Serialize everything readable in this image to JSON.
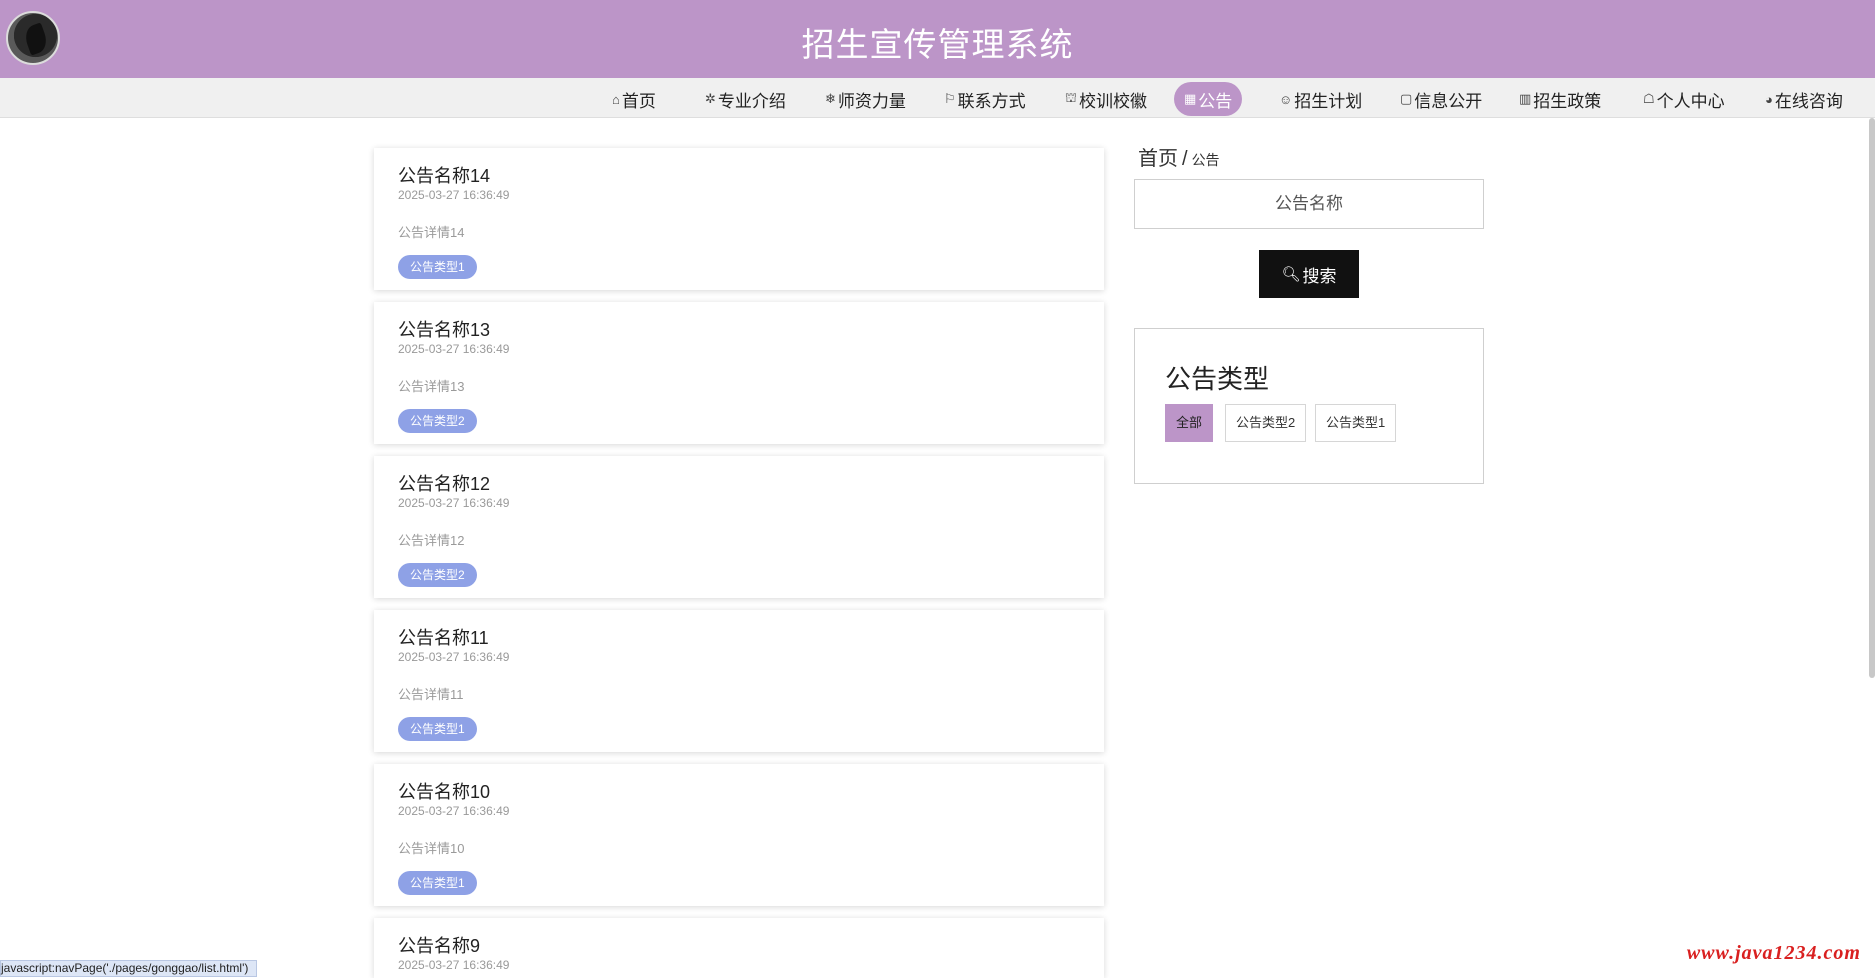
{
  "header": {
    "site_title": "招生宣传管理系统",
    "logo_icon": "avatar-logo"
  },
  "nav": {
    "items": [
      {
        "icon": "home-icon",
        "glyph": "⌂",
        "label": "首页"
      },
      {
        "icon": "star-outline-icon",
        "glyph": "✲",
        "label": "专业介绍"
      },
      {
        "icon": "snowflake-icon",
        "glyph": "❄",
        "label": "师资力量"
      },
      {
        "icon": "flag-icon",
        "glyph": "⚐",
        "label": "联系方式"
      },
      {
        "icon": "gift-icon",
        "glyph": "⛫",
        "label": "校训校徽"
      },
      {
        "icon": "grid-icon",
        "glyph": "▦",
        "label": "公告",
        "active": true
      },
      {
        "icon": "face-icon",
        "glyph": "☺",
        "label": "招生计划"
      },
      {
        "icon": "note-icon",
        "glyph": "▢",
        "label": "信息公开"
      },
      {
        "icon": "book-icon",
        "glyph": "▥",
        "label": "招生政策"
      },
      {
        "icon": "user-icon",
        "glyph": "☖",
        "label": "个人中心"
      },
      {
        "icon": "chat-icon",
        "glyph": "◕",
        "label": "在线咨询"
      }
    ],
    "accent_color": "#bc95c8"
  },
  "notices": [
    {
      "title": "公告名称14",
      "time": "2025-03-27 16:36:49",
      "detail": "公告详情14",
      "tag": "公告类型1"
    },
    {
      "title": "公告名称13",
      "time": "2025-03-27 16:36:49",
      "detail": "公告详情13",
      "tag": "公告类型2"
    },
    {
      "title": "公告名称12",
      "time": "2025-03-27 16:36:49",
      "detail": "公告详情12",
      "tag": "公告类型2"
    },
    {
      "title": "公告名称11",
      "time": "2025-03-27 16:36:49",
      "detail": "公告详情11",
      "tag": "公告类型1"
    },
    {
      "title": "公告名称10",
      "time": "2025-03-27 16:36:49",
      "detail": "公告详情10",
      "tag": "公告类型1"
    },
    {
      "title": "公告名称9",
      "time": "2025-03-27 16:36:49",
      "detail": "",
      "tag": ""
    }
  ],
  "breadcrumb": {
    "home": "首页",
    "separator": "/",
    "current": "公告"
  },
  "search": {
    "placeholder": "公告名称",
    "value": "",
    "button_label": "搜索",
    "button_icon": "search-icon"
  },
  "types": {
    "title": "公告类型",
    "options": [
      {
        "label": "全部",
        "active": true
      },
      {
        "label": "公告类型2",
        "active": false
      },
      {
        "label": "公告类型1",
        "active": false
      }
    ]
  },
  "status_bar": {
    "text": "javascript:navPage('./pages/gonggao/list.html')"
  },
  "watermark": {
    "text": "www.java1234.com"
  },
  "colors": {
    "header_bg": "#bc95c8",
    "tag_bg": "#8ea1e6",
    "button_bg": "#111111"
  }
}
